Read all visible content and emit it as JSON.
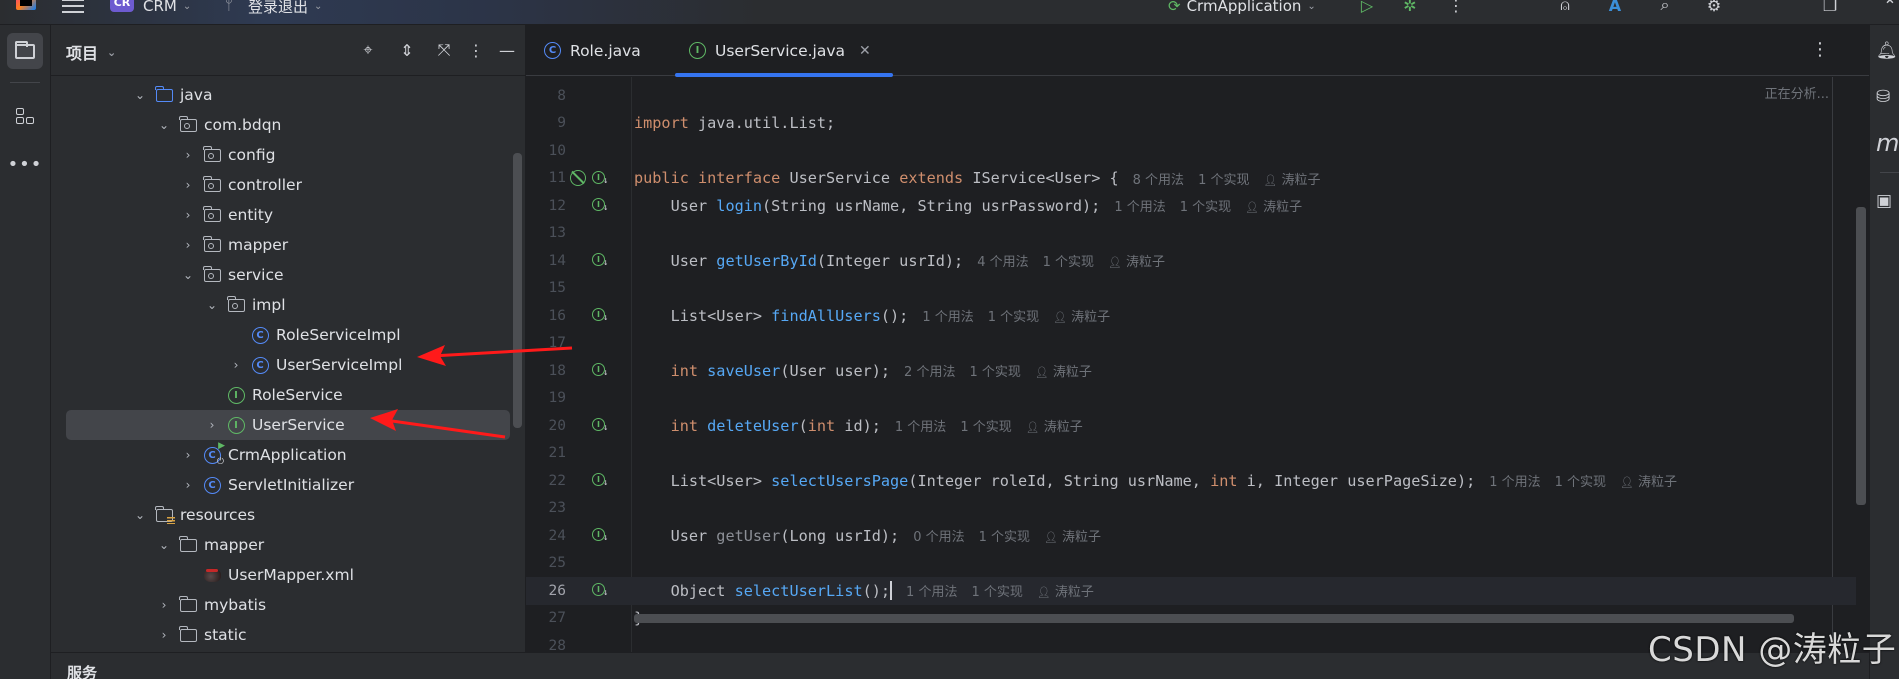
{
  "titlebar": {
    "project_badge": "CR",
    "project_name": "CRM",
    "branch_name": "登录退出",
    "run_config": "CrmApplication",
    "icons": [
      "menu-icon",
      "branch-icon",
      "run-icon",
      "debug-icon",
      "more-icon",
      "add-user-icon",
      "translate-icon",
      "search-icon",
      "settings-icon",
      "restore-window-icon",
      "collapse-icon"
    ]
  },
  "left_strip": {
    "icons": [
      "project-folder-icon",
      "structure-icon",
      "more-tools-icon"
    ],
    "more_label": "•••"
  },
  "project_panel": {
    "title": "项目",
    "header_icons": [
      "locate-icon",
      "expand-all-icon",
      "collapse-all-icon",
      "options-icon",
      "hide-icon"
    ],
    "tree": [
      {
        "label": "java",
        "depth": 0,
        "expanded": true,
        "icon": "source-folder"
      },
      {
        "label": "com.bdqn",
        "depth": 1,
        "expanded": true,
        "icon": "package"
      },
      {
        "label": "config",
        "depth": 2,
        "expanded": false,
        "icon": "package"
      },
      {
        "label": "controller",
        "depth": 2,
        "expanded": false,
        "icon": "package"
      },
      {
        "label": "entity",
        "depth": 2,
        "expanded": false,
        "icon": "package"
      },
      {
        "label": "mapper",
        "depth": 2,
        "expanded": false,
        "icon": "package"
      },
      {
        "label": "service",
        "depth": 2,
        "expanded": true,
        "icon": "package"
      },
      {
        "label": "impl",
        "depth": 3,
        "expanded": true,
        "icon": "package"
      },
      {
        "label": "RoleServiceImpl",
        "depth": 4,
        "expanded": null,
        "icon": "class"
      },
      {
        "label": "UserServiceImpl",
        "depth": 4,
        "expanded": false,
        "icon": "class"
      },
      {
        "label": "RoleService",
        "depth": 3,
        "expanded": null,
        "icon": "interface"
      },
      {
        "label": "UserService",
        "depth": 3,
        "expanded": false,
        "icon": "interface",
        "selected": true
      },
      {
        "label": "CrmApplication",
        "depth": 2,
        "expanded": false,
        "icon": "spring-app"
      },
      {
        "label": "ServletInitializer",
        "depth": 2,
        "expanded": false,
        "icon": "class"
      },
      {
        "label": "resources",
        "depth": 0,
        "expanded": true,
        "icon": "resources-folder"
      },
      {
        "label": "mapper",
        "depth": 1,
        "expanded": true,
        "icon": "folder"
      },
      {
        "label": "UserMapper.xml",
        "depth": 2,
        "expanded": null,
        "icon": "mybatis-xml"
      },
      {
        "label": "mybatis",
        "depth": 1,
        "expanded": false,
        "icon": "folder"
      },
      {
        "label": "static",
        "depth": 1,
        "expanded": false,
        "icon": "folder"
      }
    ]
  },
  "bottom_bar": {
    "services_label": "服务"
  },
  "editor": {
    "tabs": [
      {
        "label": "Role.java",
        "icon": "class",
        "active": false
      },
      {
        "label": "UserService.java",
        "icon": "interface",
        "active": true,
        "closable": true
      }
    ],
    "close_glyph": "✕",
    "status": "正在分析...",
    "current_line": 26,
    "lines": [
      {
        "n": 8,
        "tokens": [],
        "gutter": ""
      },
      {
        "n": 9,
        "tokens": [
          [
            "kw",
            "import "
          ],
          [
            "pl",
            "java.util.List;"
          ]
        ],
        "gutter": ""
      },
      {
        "n": 10,
        "tokens": [],
        "gutter": ""
      },
      {
        "n": 11,
        "tokens": [
          [
            "kw",
            "public interface "
          ],
          [
            "pl",
            "UserService "
          ],
          [
            "kw",
            "extends "
          ],
          [
            "pl",
            "IService<User> {"
          ]
        ],
        "gutter": "implemented-with-no-bean",
        "hint": {
          "usages": "8 个用法",
          "impls": "1 个实现",
          "author": "涛粒子"
        }
      },
      {
        "n": 12,
        "tokens": [
          [
            "pl",
            "    User "
          ],
          [
            "fn",
            "login"
          ],
          [
            "pl",
            "(String usrName, String usrPassword);"
          ]
        ],
        "gutter": "implemented",
        "hint": {
          "usages": "1 个用法",
          "impls": "1 个实现",
          "author": "涛粒子"
        }
      },
      {
        "n": 13,
        "tokens": [],
        "gutter": ""
      },
      {
        "n": 14,
        "tokens": [
          [
            "pl",
            "    User "
          ],
          [
            "fn",
            "getUserById"
          ],
          [
            "pl",
            "(Integer usrId);"
          ]
        ],
        "gutter": "implemented",
        "hint": {
          "usages": "4 个用法",
          "impls": "1 个实现",
          "author": "涛粒子"
        }
      },
      {
        "n": 15,
        "tokens": [],
        "gutter": ""
      },
      {
        "n": 16,
        "tokens": [
          [
            "pl",
            "    List<User> "
          ],
          [
            "fn",
            "findAllUsers"
          ],
          [
            "pl",
            "();"
          ]
        ],
        "gutter": "implemented",
        "hint": {
          "usages": "1 个用法",
          "impls": "1 个实现",
          "author": "涛粒子"
        }
      },
      {
        "n": 17,
        "tokens": [],
        "gutter": ""
      },
      {
        "n": 18,
        "tokens": [
          [
            "kw",
            "    int "
          ],
          [
            "fn",
            "saveUser"
          ],
          [
            "pl",
            "(User user);"
          ]
        ],
        "gutter": "implemented",
        "hint": {
          "usages": "2 个用法",
          "impls": "1 个实现",
          "author": "涛粒子"
        }
      },
      {
        "n": 19,
        "tokens": [],
        "gutter": ""
      },
      {
        "n": 20,
        "tokens": [
          [
            "kw",
            "    int "
          ],
          [
            "fn",
            "deleteUser"
          ],
          [
            "pl",
            "("
          ],
          [
            "kw",
            "int "
          ],
          [
            "pl",
            "id);"
          ]
        ],
        "gutter": "implemented",
        "hint": {
          "usages": "1 个用法",
          "impls": "1 个实现",
          "author": "涛粒子"
        }
      },
      {
        "n": 21,
        "tokens": [],
        "gutter": ""
      },
      {
        "n": 22,
        "tokens": [
          [
            "pl",
            "    List<User> "
          ],
          [
            "fn",
            "selectUsersPage"
          ],
          [
            "pl",
            "(Integer roleId, String usrName, "
          ],
          [
            "kw",
            "int "
          ],
          [
            "pl",
            "i, Integer userPageSize);"
          ]
        ],
        "gutter": "implemented",
        "hint": {
          "usages": "1 个用法",
          "impls": "1 个实现",
          "author": "涛粒子"
        }
      },
      {
        "n": 23,
        "tokens": [],
        "gutter": ""
      },
      {
        "n": 24,
        "tokens": [
          [
            "pl",
            "    User "
          ],
          [
            "unused",
            "getUser"
          ],
          [
            "pl",
            "(Long usrId);"
          ]
        ],
        "gutter": "implemented",
        "hint": {
          "usages": "0 个用法",
          "impls": "1 个实现",
          "author": "涛粒子"
        }
      },
      {
        "n": 25,
        "tokens": [],
        "gutter": ""
      },
      {
        "n": 26,
        "tokens": [
          [
            "pl",
            "    Object "
          ],
          [
            "fn",
            "selectUserList"
          ],
          [
            "pl",
            "();"
          ]
        ],
        "gutter": "implemented",
        "caret": true,
        "hint": {
          "usages": "1 个用法",
          "impls": "1 个实现",
          "author": "涛粒子"
        }
      },
      {
        "n": 27,
        "tokens": [
          [
            "pl",
            "}"
          ]
        ],
        "gutter": ""
      },
      {
        "n": 28,
        "tokens": [],
        "gutter": ""
      }
    ]
  },
  "right_strip": {
    "icons": [
      "notifications-icon",
      "database-icon",
      "maven-icon",
      "ai-assistant-icon"
    ],
    "maven_glyph": "m"
  },
  "annotations": {
    "arrow_color": "#ff1a1a",
    "arrows": [
      "arrow-to-UserServiceImpl",
      "arrow-to-UserService"
    ]
  },
  "watermark": "CSDN @涛粒子",
  "colors": {
    "accent": "#3574f0",
    "keyword": "#cf8e6d",
    "method": "#56a8f5",
    "interface_icon": "#5fb865",
    "class_icon": "#548af7"
  }
}
